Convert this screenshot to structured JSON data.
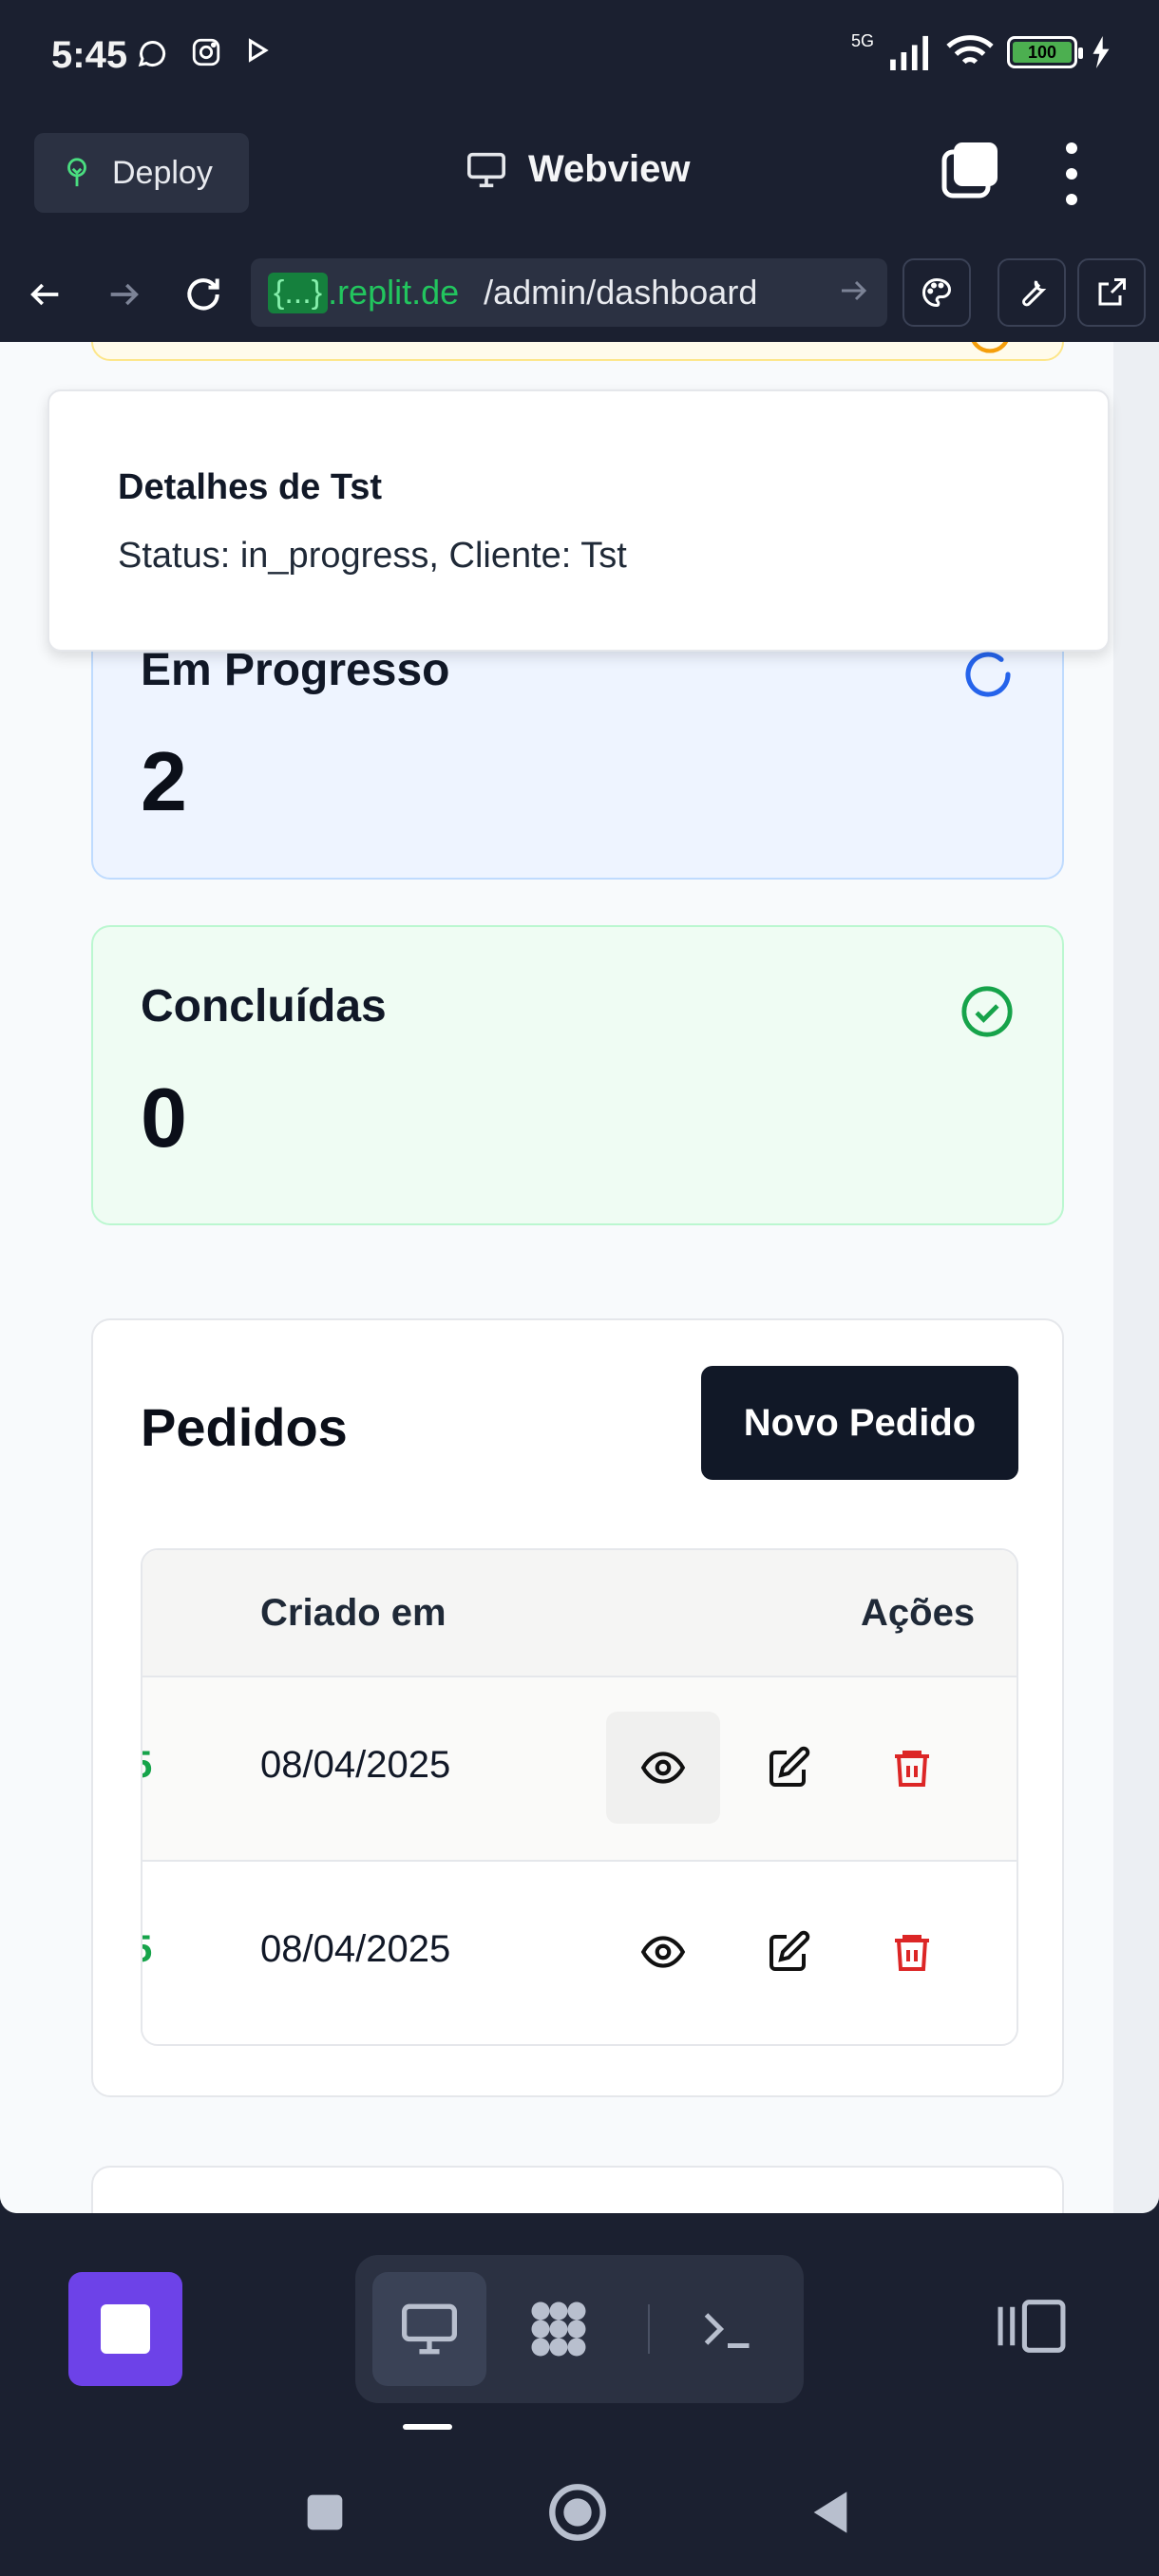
{
  "status_bar": {
    "time": "5:45",
    "network": "5G",
    "battery": "100"
  },
  "app_header": {
    "deploy_label": "Deploy",
    "title": "Webview"
  },
  "url_bar": {
    "brace": "{...}",
    "domain": ".replit.de",
    "path": "/admin/dashboard"
  },
  "toast": {
    "title": "Detalhes de Tst",
    "description": "Status: in_progress, Cliente: Tst"
  },
  "stats": {
    "in_progress": {
      "label": "Em Progresso",
      "value": "2"
    },
    "completed": {
      "label": "Concluídas",
      "value": "0"
    }
  },
  "orders": {
    "title": "Pedidos",
    "new_button": "Novo Pedido",
    "columns": {
      "created": "Criado em",
      "actions": "Ações"
    },
    "rows": [
      {
        "id_tail": "5",
        "created": "08/04/2025"
      },
      {
        "id_tail": "5",
        "created": "08/04/2025"
      }
    ]
  },
  "colors": {
    "accent_purple": "#6d42e8",
    "progress_blue": "#2563eb",
    "success_green": "#16a34a",
    "danger_red": "#dc2626",
    "dark_bg": "#1b2030"
  },
  "icons": {
    "deploy": "deploy-tree-icon",
    "webview": "monitor-icon",
    "progress": "spinner-icon",
    "done": "check-circle-icon",
    "view": "eye-icon",
    "edit": "edit-icon",
    "delete": "trash-icon"
  }
}
